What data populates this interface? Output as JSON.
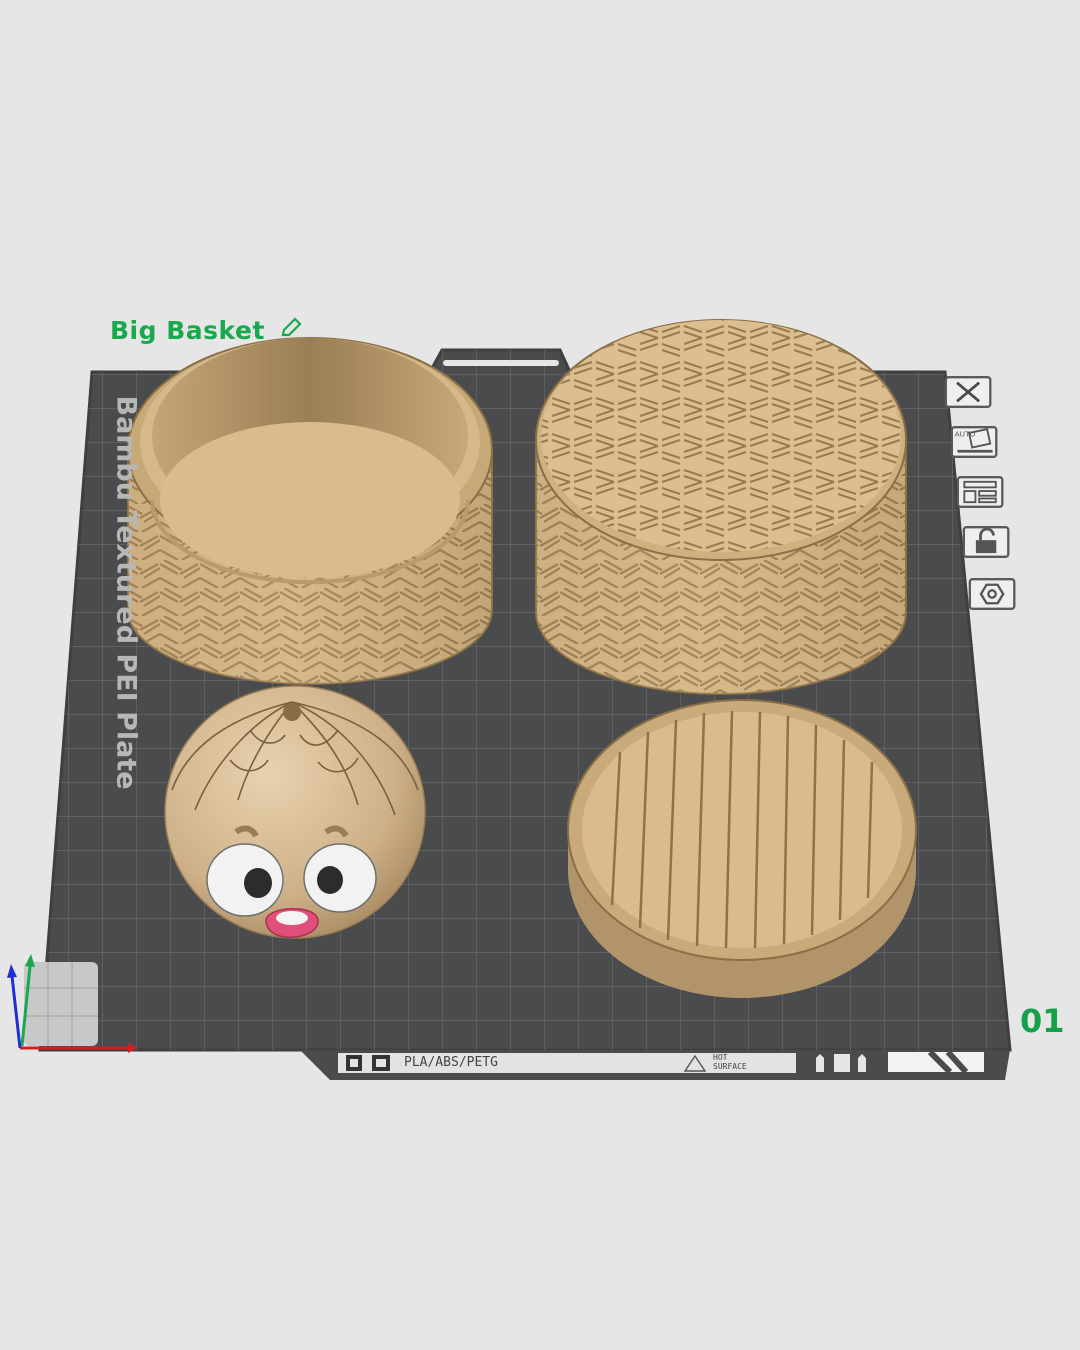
{
  "plate": {
    "title": "Big Basket",
    "number": "01",
    "plate_name": "Bambu Textured PEI Plate"
  },
  "bottom_strip": {
    "filament_types": "PLA/ABS/PETG",
    "warning_line1": "HOT",
    "warning_line2": "SURFACE"
  },
  "tools": [
    {
      "icon": "close-icon"
    },
    {
      "icon": "auto-orient-icon",
      "label": "AUTO"
    },
    {
      "icon": "arrange-icon"
    },
    {
      "icon": "lock-icon"
    },
    {
      "icon": "settings-icon"
    }
  ],
  "colors": {
    "background": "#e6e6e7",
    "plate": "#4a4b4d",
    "grid": "#6c6d70",
    "model": "#cfb07f",
    "plate_title": "#1aa84f",
    "axis_x": "#d11f1f",
    "axis_y": "#1aa84f",
    "axis_z": "#1f2fd1"
  }
}
